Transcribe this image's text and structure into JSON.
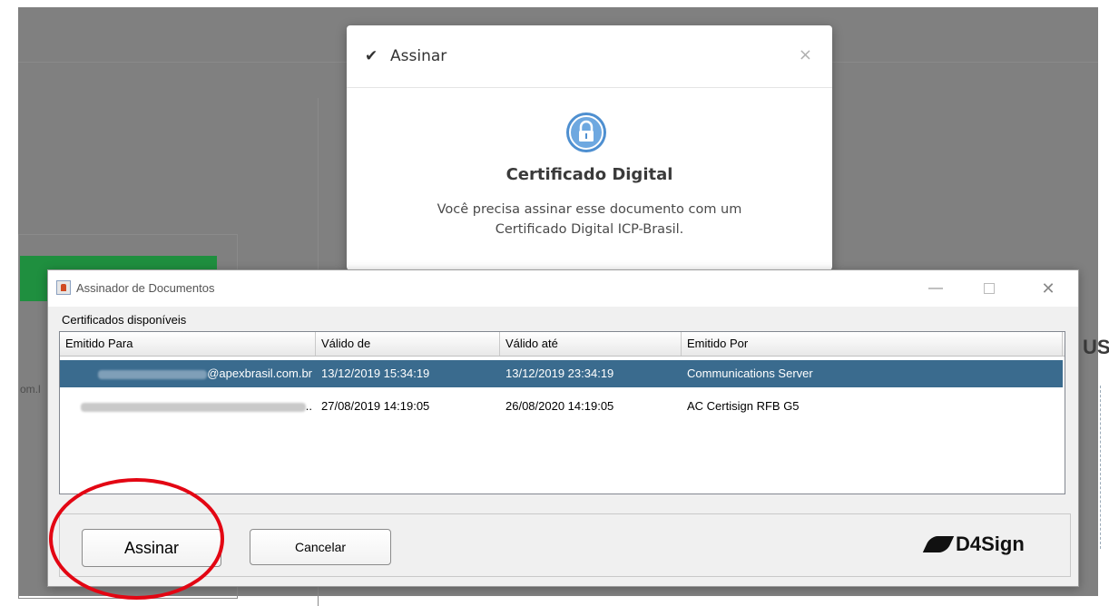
{
  "background": {
    "side_text": "om.l",
    "right_text": "US"
  },
  "web_modal": {
    "title": "Assinar",
    "close_symbol": "×",
    "icon": "lock-icon",
    "heading": "Certificado Digital",
    "description": "Você precisa assinar esse documento com um Certificado Digital ICP-Brasil."
  },
  "java_dialog": {
    "title": "Assinador de Documentos",
    "controls": {
      "minimize": "—",
      "close": "✕"
    },
    "section_label": "Certificados disponíveis",
    "columns": [
      "Emitido Para",
      "Válido de",
      "Válido até",
      "Emitido Por"
    ],
    "rows": [
      {
        "issued_to": "@apexbrasil.com.br",
        "valid_from": "13/12/2019 15:34:19",
        "valid_to": "13/12/2019 23:34:19",
        "issued_by": "Communications Server",
        "selected": true
      },
      {
        "issued_to": "..",
        "valid_from": "27/08/2019 14:19:05",
        "valid_to": "26/08/2020 14:19:05",
        "issued_by": "AC Certisign RFB G5",
        "selected": false
      }
    ],
    "buttons": {
      "sign": "Assinar",
      "cancel": "Cancelar"
    },
    "logo_text": "D4Sign"
  },
  "colors": {
    "selection": "#3a6b8e",
    "highlight_circle": "#e30613",
    "lock_icon": "#4e8fd0"
  }
}
